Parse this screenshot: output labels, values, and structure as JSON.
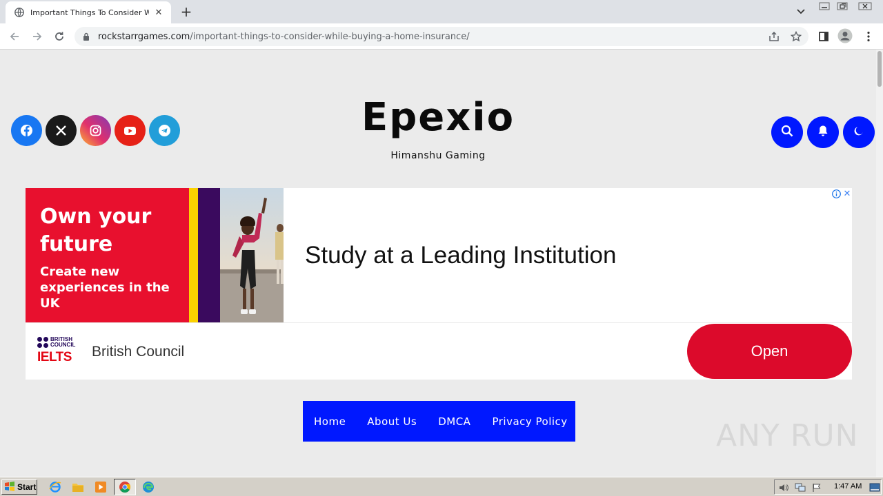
{
  "browser": {
    "tab": {
      "title": "Important Things To Consider While Buying a Home Insurance",
      "favicon": "globe-icon"
    },
    "new_tab_label": "+",
    "url_host": "rockstarrgames.com",
    "url_path": "/important-things-to-consider-while-buying-a-home-insurance/"
  },
  "site": {
    "title": "Epexio",
    "tagline": "Himanshu Gaming",
    "social": [
      {
        "name": "facebook",
        "icon": "facebook-icon",
        "color": "#1877f2"
      },
      {
        "name": "x",
        "icon": "x-icon",
        "color": "#1a1a1a"
      },
      {
        "name": "instagram",
        "icon": "instagram-icon",
        "color": "#d6249f"
      },
      {
        "name": "youtube",
        "icon": "youtube-icon",
        "color": "#e62117"
      },
      {
        "name": "telegram",
        "icon": "telegram-icon",
        "color": "#229ed9"
      }
    ],
    "accent_color": "#0018ff"
  },
  "ad": {
    "headline": "Own your future",
    "subheadline": "Create new experiences in the UK",
    "main_text": "Study at a Leading Institution",
    "advertiser": "British Council",
    "logo_text_1": "BRITISH",
    "logo_text_2": "COUNCIL",
    "logo_brand": "IELTS",
    "cta_label": "Open",
    "cta_color": "#dc0a2b",
    "info_icon": "info-icon",
    "close_label": "✕"
  },
  "menu": {
    "items": [
      {
        "label": "Home"
      },
      {
        "label": "About Us"
      },
      {
        "label": "DMCA"
      },
      {
        "label": "Privacy Policy"
      }
    ]
  },
  "watermark": {
    "text": "ANY RUN"
  },
  "taskbar": {
    "start_label": "Start",
    "clock": "1:47 AM"
  }
}
